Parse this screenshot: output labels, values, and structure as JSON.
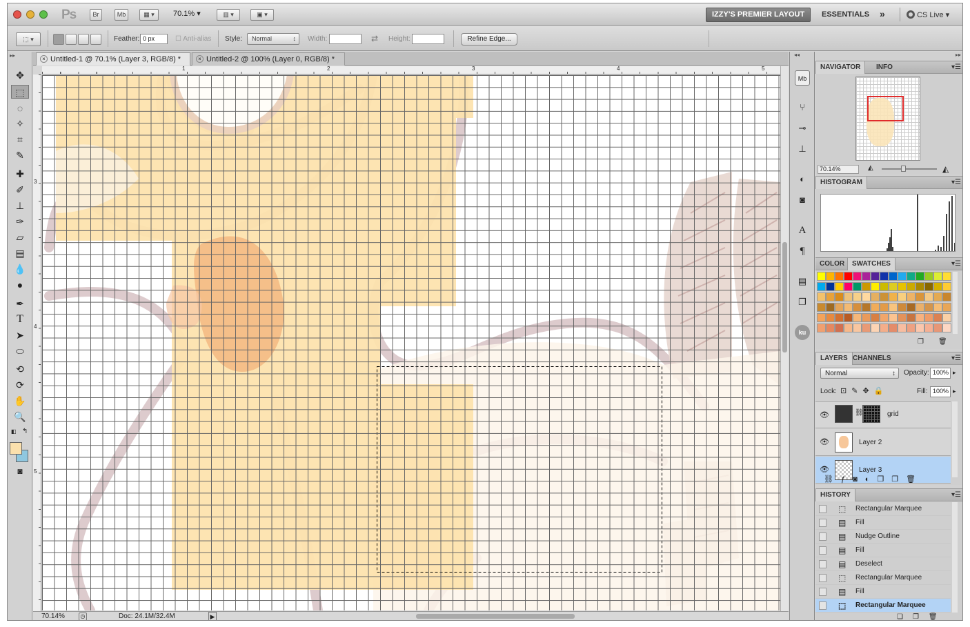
{
  "appbar": {
    "ps": "Ps",
    "br": "Br",
    "mb": "Mb",
    "zoom": "70.1%",
    "workspace": "IZZY'S PREMIER LAYOUT",
    "essentials": "ESSENTIALS",
    "more": "»",
    "cslive": "CS Live"
  },
  "options": {
    "feather_label": "Feather:",
    "feather_value": "0 px",
    "antialias": "Anti-alias",
    "style_label": "Style:",
    "style_value": "Normal",
    "width_label": "Width:",
    "height_label": "Height:",
    "refine": "Refine Edge..."
  },
  "tabs": [
    {
      "label": "Untitled-1 @ 70.1% (Layer 3, RGB/8) *"
    },
    {
      "label": "Untitled-2 @ 100% (Layer 0, RGB/8) *"
    }
  ],
  "ruler": {
    "h": [
      "1",
      "2",
      "3",
      "4",
      "5"
    ],
    "v": [
      "3",
      "4",
      "5"
    ]
  },
  "status": {
    "zoom": "70.14%",
    "doc": "Doc: 24.1M/32.4M"
  },
  "navigator": {
    "tab1": "NAVIGATOR",
    "tab2": "INFO",
    "zoom": "70.14%"
  },
  "histogram": {
    "tab": "HISTOGRAM"
  },
  "color": {
    "tab1": "COLOR",
    "tab2": "SWATCHES"
  },
  "layers": {
    "tab1": "LAYERS",
    "tab2": "CHANNELS",
    "blend": "Normal",
    "opacity_label": "Opacity:",
    "opacity": "100%",
    "lock_label": "Lock:",
    "fill_label": "Fill:",
    "fill": "100%",
    "items": [
      {
        "name": "grid"
      },
      {
        "name": "Layer 2"
      },
      {
        "name": "Layer 3"
      }
    ]
  },
  "history": {
    "tab": "HISTORY",
    "items": [
      "Rectangular Marquee",
      "Fill",
      "Nudge Outline",
      "Fill",
      "Deselect",
      "Rectangular Marquee",
      "Fill",
      "Rectangular Marquee"
    ]
  }
}
